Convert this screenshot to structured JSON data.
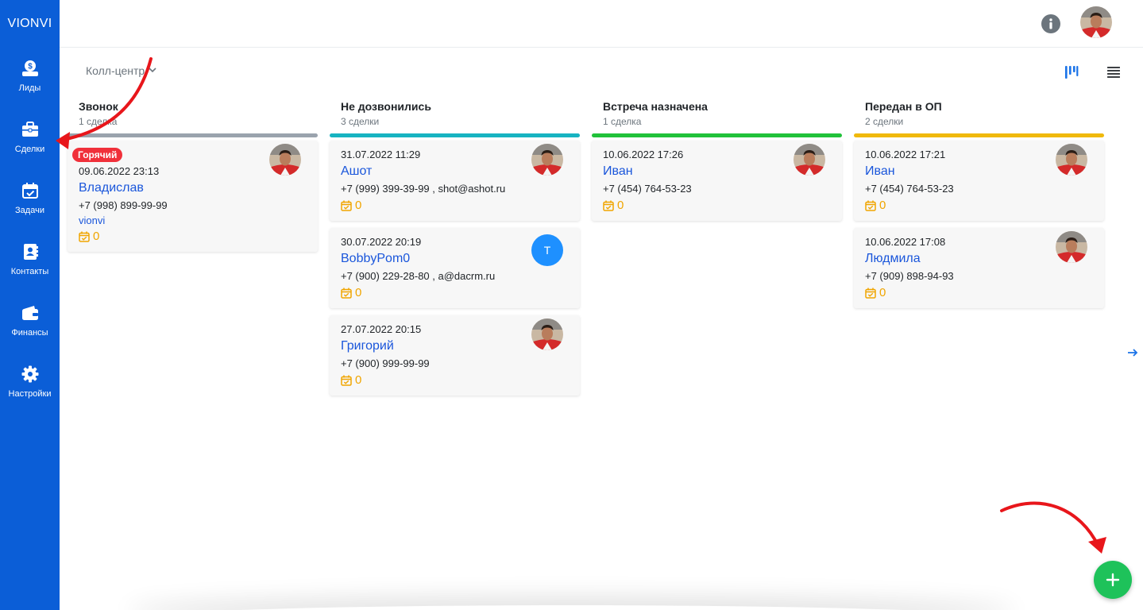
{
  "brand": "VIONVI",
  "sidebar": {
    "items": [
      {
        "label": "Лиды",
        "icon": "money-bag-icon"
      },
      {
        "label": "Сделки",
        "icon": "briefcase-icon"
      },
      {
        "label": "Задачи",
        "icon": "calendar-check-icon"
      },
      {
        "label": "Контакты",
        "icon": "contact-book-icon"
      },
      {
        "label": "Финансы",
        "icon": "wallet-icon"
      },
      {
        "label": "Настройки",
        "icon": "gear-icon"
      }
    ]
  },
  "toolbar": {
    "pipeline": "Колл-центр"
  },
  "columns": [
    {
      "title": "Звонок",
      "count": "1 сделка",
      "color": "#9aa3ad",
      "cards": [
        {
          "badge": "Горячий",
          "date": "09.06.2022 23:13",
          "name": "Владислав",
          "phone": "+7 (998) 899-99-99",
          "tag": "vionvi",
          "tasks": "0",
          "avatar": "photo"
        }
      ]
    },
    {
      "title": "Не дозвонились",
      "count": "3 сделки",
      "color": "#17b3c1",
      "cards": [
        {
          "date": "31.07.2022 11:29",
          "name": "Ашот",
          "phone": "+7 (999) 399-39-99 , shot@ashot.ru",
          "tasks": "0",
          "avatar": "photo"
        },
        {
          "date": "30.07.2022 20:19",
          "name": "BobbyPom0",
          "phone": "+7 (900) 229-28-80 , a@dacrm.ru",
          "tasks": "0",
          "avatar_letter": "T"
        },
        {
          "date": "27.07.2022 20:15",
          "name": "Григорий",
          "phone": "+7 (900) 999-99-99",
          "tasks": "0",
          "avatar": "photo"
        }
      ]
    },
    {
      "title": "Встреча назначена",
      "count": "1 сделка",
      "color": "#21c23a",
      "cards": [
        {
          "date": "10.06.2022 17:26",
          "name": "Иван",
          "phone": "+7 (454) 764-53-23",
          "tasks": "0",
          "avatar": "photo"
        }
      ]
    },
    {
      "title": "Передан в ОП",
      "count": "2 сделки",
      "color": "#f0b90b",
      "cards": [
        {
          "date": "10.06.2022 17:21",
          "name": "Иван",
          "phone": "+7 (454) 764-53-23",
          "tasks": "0",
          "avatar": "photo"
        },
        {
          "date": "10.06.2022 17:08",
          "name": "Людмила",
          "phone": "+7 (909) 898-94-93",
          "tasks": "0",
          "avatar": "photo"
        }
      ]
    }
  ],
  "colors": {
    "sidebar": "#0b5ed7",
    "link": "#1a56db",
    "task": "#f0a500",
    "fab": "#1ec25a",
    "annotation": "#e8161b"
  }
}
